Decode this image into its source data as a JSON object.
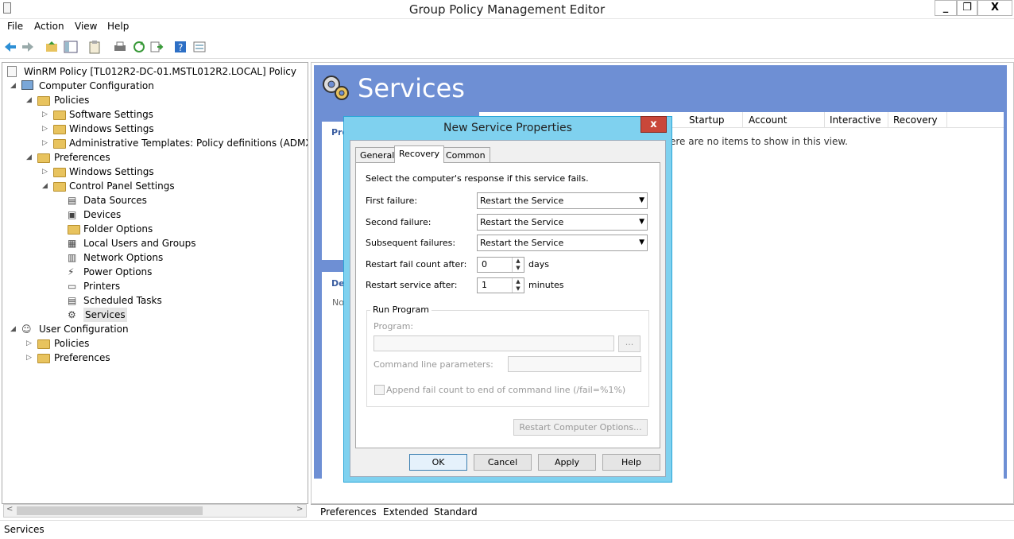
{
  "window": {
    "title": "Group Policy Management Editor",
    "minimize": "_",
    "restore": "❐",
    "close": "X"
  },
  "menu": [
    "File",
    "Action",
    "View",
    "Help"
  ],
  "tree": {
    "root": "WinRM Policy [TL012R2-DC-01.MSTL012R2.LOCAL] Policy",
    "computer_config": "Computer Configuration",
    "policies": "Policies",
    "software_settings": "Software Settings",
    "windows_settings": "Windows Settings",
    "admin_templates": "Administrative Templates: Policy definitions (ADMX files)",
    "preferences": "Preferences",
    "pref_windows_settings": "Windows Settings",
    "control_panel": "Control Panel Settings",
    "cp_items": [
      "Data Sources",
      "Devices",
      "Folder Options",
      "Local Users and Groups",
      "Network Options",
      "Power Options",
      "Printers",
      "Scheduled Tasks",
      "Services"
    ],
    "user_config": "User Configuration",
    "user_policies": "Policies",
    "user_preferences": "Preferences"
  },
  "right": {
    "heading": "Services",
    "columns": [
      "Startup",
      "Account",
      "Interactive",
      "Recovery"
    ],
    "empty_text": "ere are no items to show in this view.",
    "panel1_label": "Pro",
    "panel2_label": "De",
    "panel2_text": "No"
  },
  "bottom_tabs": [
    "Preferences",
    "Extended",
    "Standard"
  ],
  "status": "Services",
  "dialog": {
    "title": "New Service Properties",
    "close": "x",
    "tabs": [
      "General",
      "Recovery",
      "Common"
    ],
    "instruction": "Select the computer's response if this service fails.",
    "first_failure_label": "First failure:",
    "first_failure_value": "Restart the Service",
    "second_failure_label": "Second failure:",
    "second_failure_value": "Restart the Service",
    "subsequent_label": "Subsequent failures:",
    "subsequent_value": "Restart the Service",
    "reset_label": "Restart fail count after:",
    "reset_value": "0",
    "reset_unit": "days",
    "restart_label": "Restart service after:",
    "restart_value": "1",
    "restart_unit": "minutes",
    "run_program_group": "Run Program",
    "program_label": "Program:",
    "program_value": "",
    "browse": "...",
    "cmdline_label": "Command line parameters:",
    "cmdline_value": "",
    "append_label": "Append fail count to end of command line (/fail=%1%)",
    "restart_computer_button": "Restart Computer Options...",
    "ok": "OK",
    "cancel": "Cancel",
    "apply": "Apply",
    "help": "Help"
  }
}
